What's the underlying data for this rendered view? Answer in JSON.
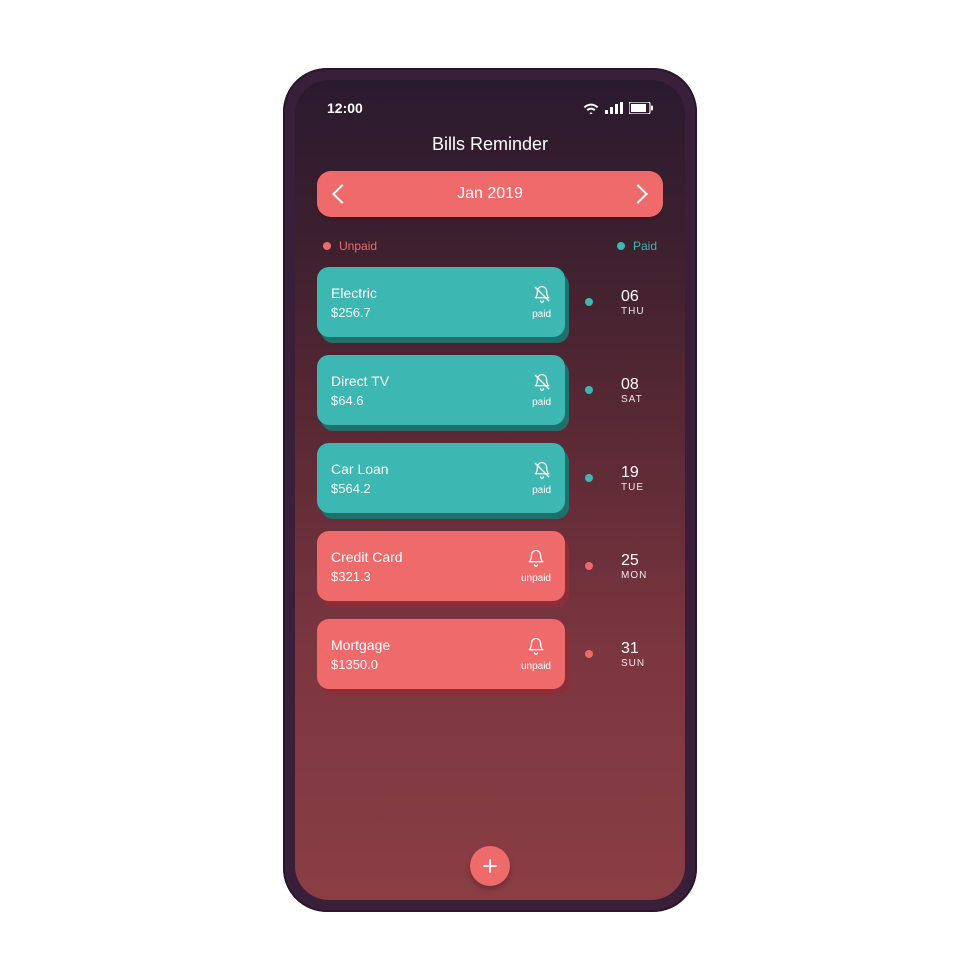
{
  "status_bar": {
    "time": "12:00"
  },
  "app": {
    "title": "Bills Reminder"
  },
  "month_selector": {
    "label": "Jan 2019"
  },
  "legend": {
    "unpaid": "Unpaid",
    "paid": "Paid"
  },
  "bills": [
    {
      "name": "Electric",
      "amount": "$256.7",
      "status": "paid",
      "day": "06",
      "weekday": "THU"
    },
    {
      "name": "Direct TV",
      "amount": "$64.6",
      "status": "paid",
      "day": "08",
      "weekday": "SAT"
    },
    {
      "name": "Car Loan",
      "amount": "$564.2",
      "status": "paid",
      "day": "19",
      "weekday": "TUE"
    },
    {
      "name": "Credit Card",
      "amount": "$321.3",
      "status": "unpaid",
      "day": "25",
      "weekday": "MON"
    },
    {
      "name": "Mortgage",
      "amount": "$1350.0",
      "status": "unpaid",
      "day": "31",
      "weekday": "SUN"
    }
  ],
  "colors": {
    "paid": "#3cb7b1",
    "unpaid": "#ef6a6a"
  }
}
